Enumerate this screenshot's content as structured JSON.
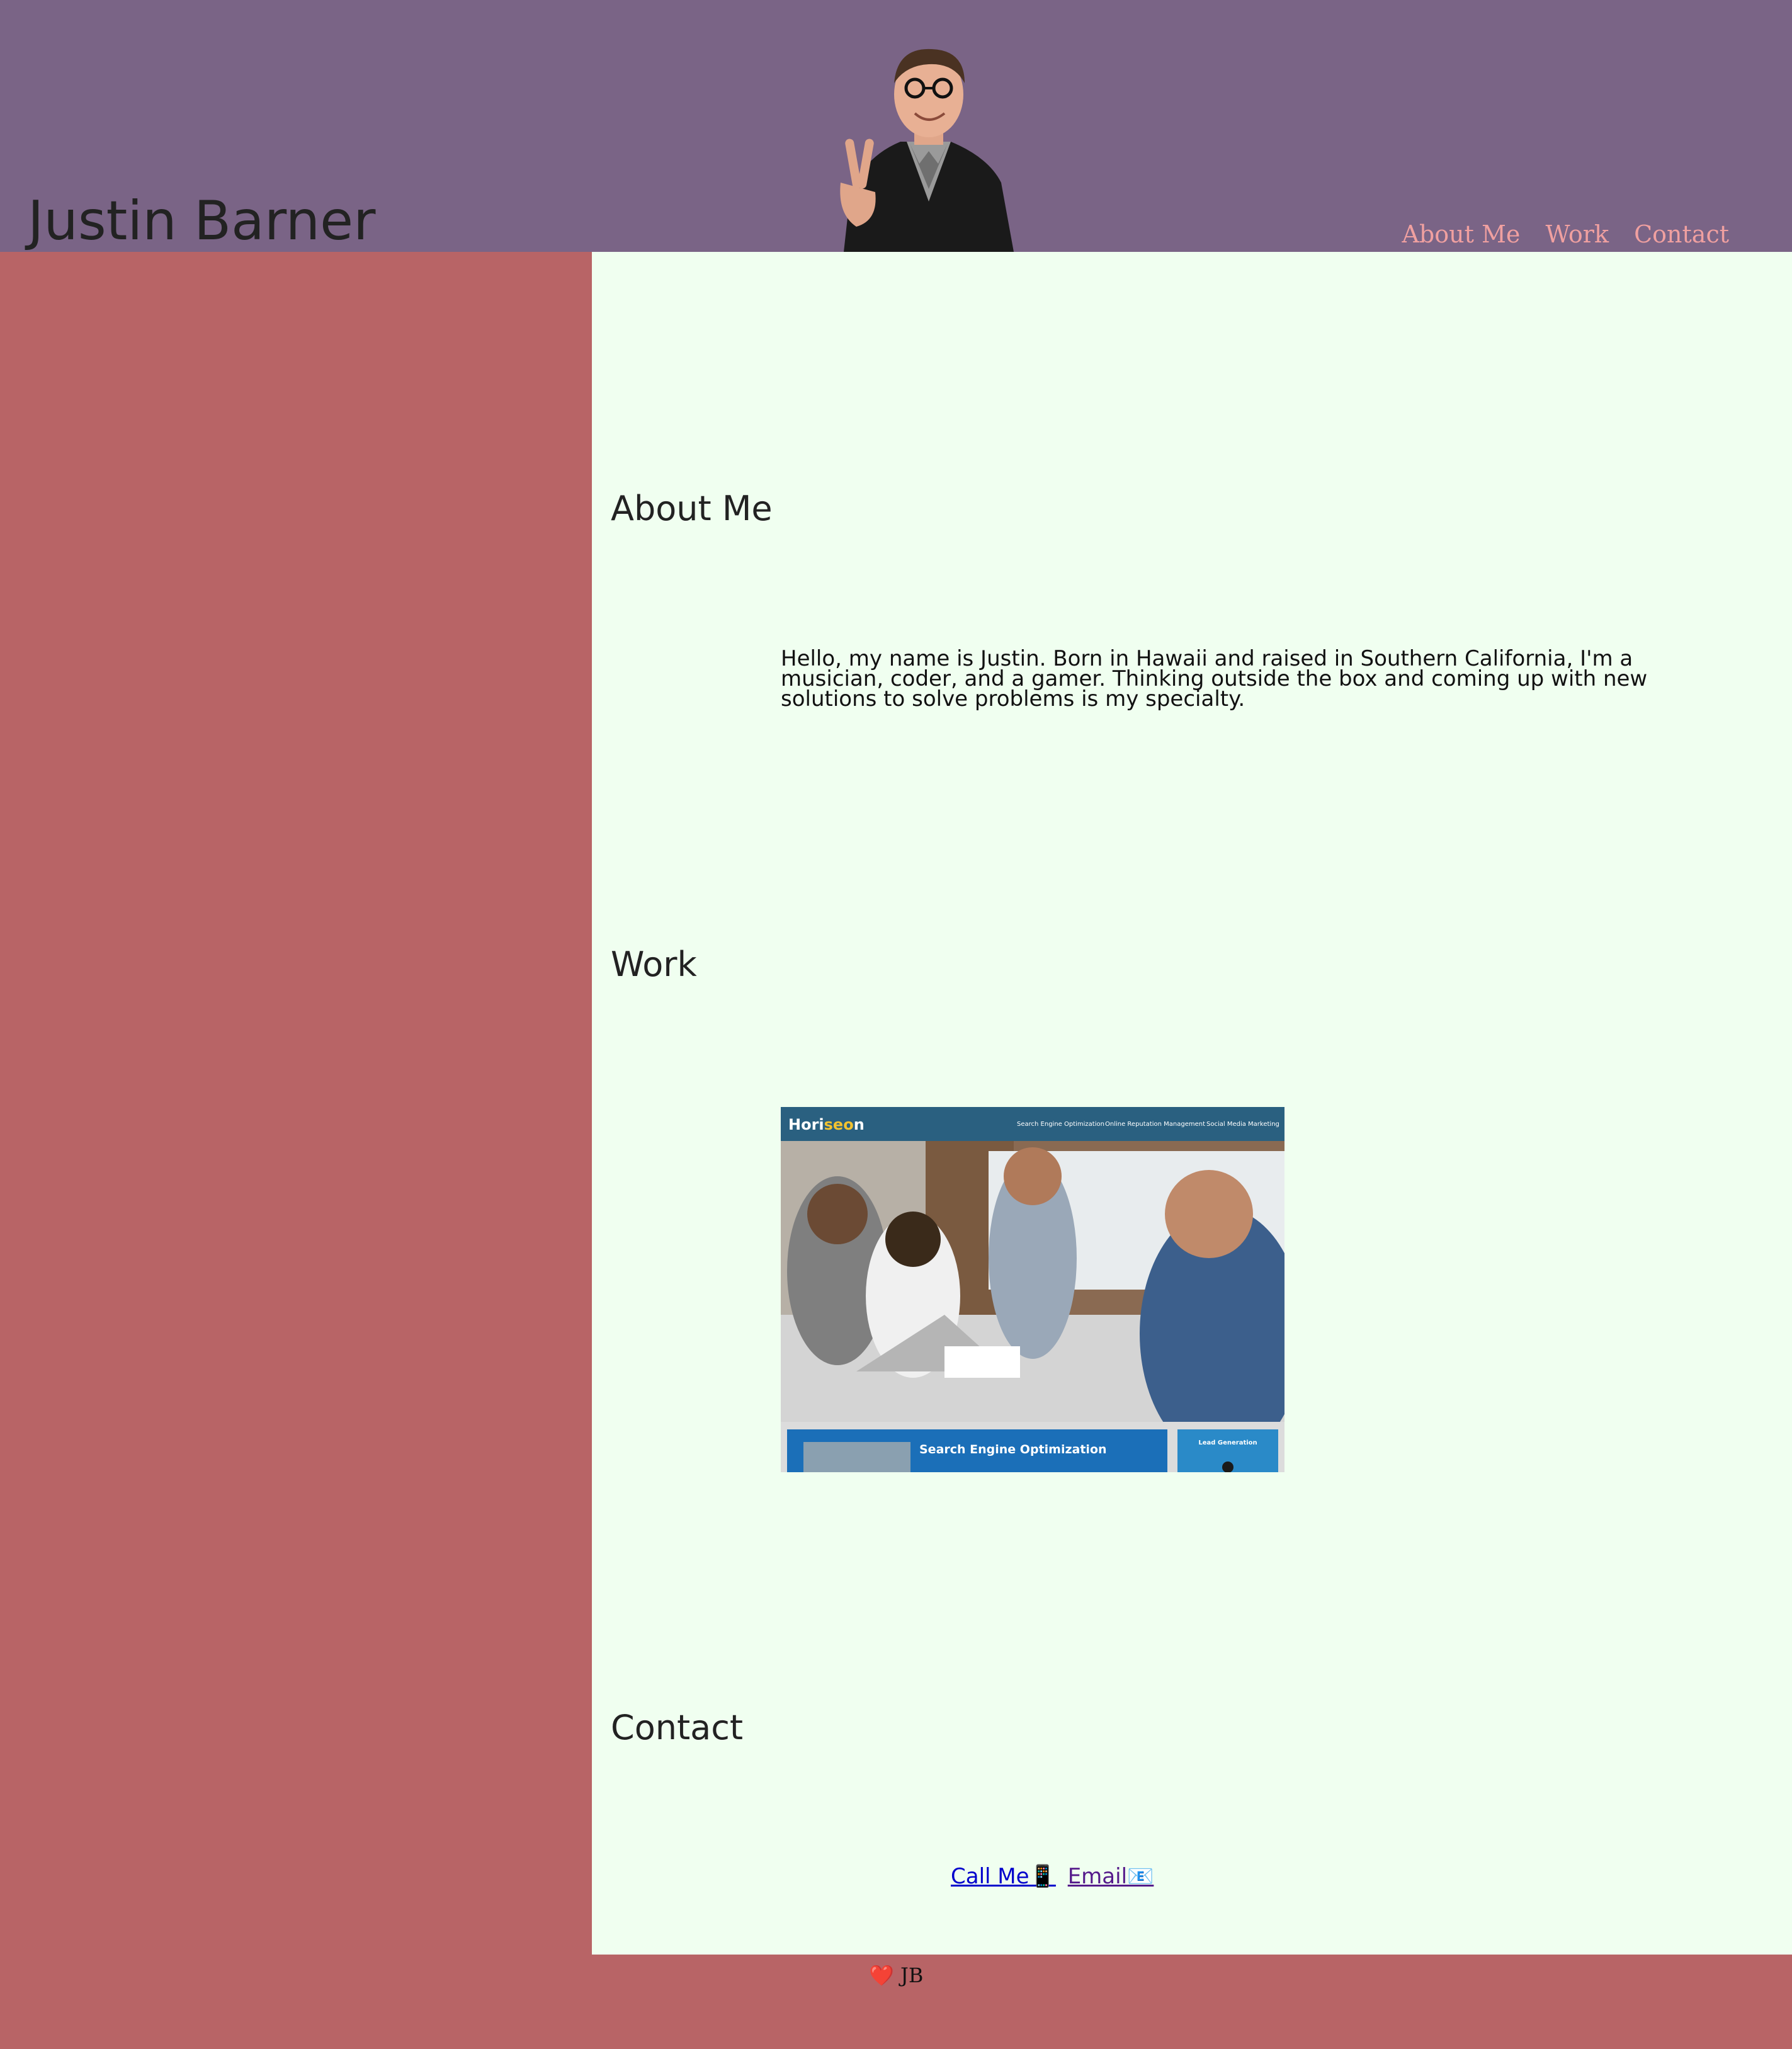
{
  "header": {
    "title": "Justin Barner",
    "nav": [
      {
        "label": "About Me"
      },
      {
        "label": "Work"
      },
      {
        "label": "Contact"
      }
    ]
  },
  "about": {
    "title": "About Me",
    "text": "Hello, my name is Justin. Born in Hawaii and raised in Southern California, I'm a musician, coder, and a gamer. Thinking outside the box and coming up with new solutions to solve problems is my specialty."
  },
  "work": {
    "title": "Work",
    "project": {
      "brand_prefix": "Hori",
      "brand_accent": "seo",
      "brand_suffix": "n",
      "nav": [
        "Search Engine Optimization",
        "Online Reputation Management",
        "Social Media Marketing"
      ],
      "feature_title": "Search Engine Optimization",
      "side_title": "Lead Generation"
    }
  },
  "contact": {
    "title": "Contact",
    "call_label": "Call Me📱",
    "email_label": "Email📧"
  },
  "footer": {
    "heart_icon": "❤️",
    "text": "JB"
  },
  "colors": {
    "header_bg": "#7a6486",
    "sidebar_bg": "#b86466",
    "main_bg": "#f0fff0",
    "nav_link": "#f0a0a0",
    "brand_accent": "#f2c230"
  }
}
